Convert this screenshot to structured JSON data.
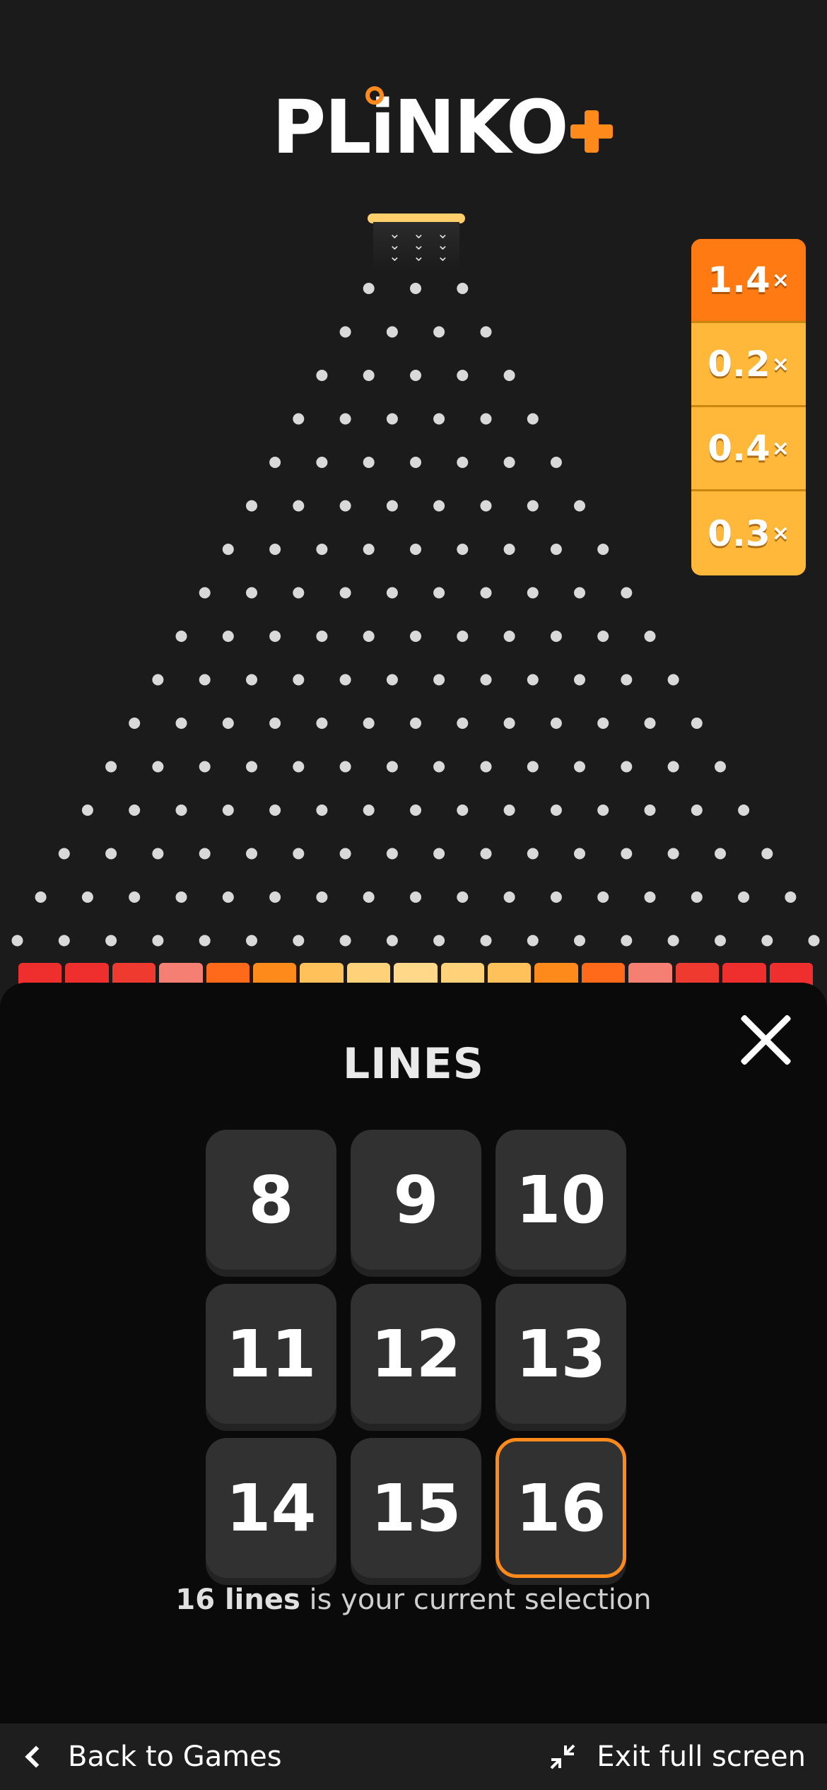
{
  "app": {
    "logo_text": "PLiNKO",
    "accent_color": "#ff8a1c"
  },
  "board": {
    "rows": 16,
    "peg_color": "#d9d9d9"
  },
  "history": [
    {
      "value": "1.4",
      "suffix": "×",
      "color": "#ff7a12"
    },
    {
      "value": "0.2",
      "suffix": "×",
      "color": "#ffb83a"
    },
    {
      "value": "0.4",
      "suffix": "×",
      "color": "#ffb83a"
    },
    {
      "value": "0.3",
      "suffix": "×",
      "color": "#ffb83a"
    }
  ],
  "slot_colors": [
    "#ef2e2e",
    "#ef2e2e",
    "#ef3a30",
    "#f57f73",
    "#ff6a1a",
    "#ff8a1c",
    "#ffc15a",
    "#ffd27a",
    "#ffd88a",
    "#ffd27a",
    "#ffc15a",
    "#ff8a1c",
    "#ff6a1a",
    "#f57f73",
    "#ef3a30",
    "#ef2e2e",
    "#ef2e2e"
  ],
  "lines_panel": {
    "title": "LINES",
    "options": [
      "8",
      "9",
      "10",
      "11",
      "12",
      "13",
      "14",
      "15",
      "16"
    ],
    "selected": "16",
    "selection_bold": "16 lines",
    "selection_rest": " is your current selection"
  },
  "bottom_bar": {
    "back_label": "Back to Games",
    "exit_label": "Exit full screen"
  }
}
